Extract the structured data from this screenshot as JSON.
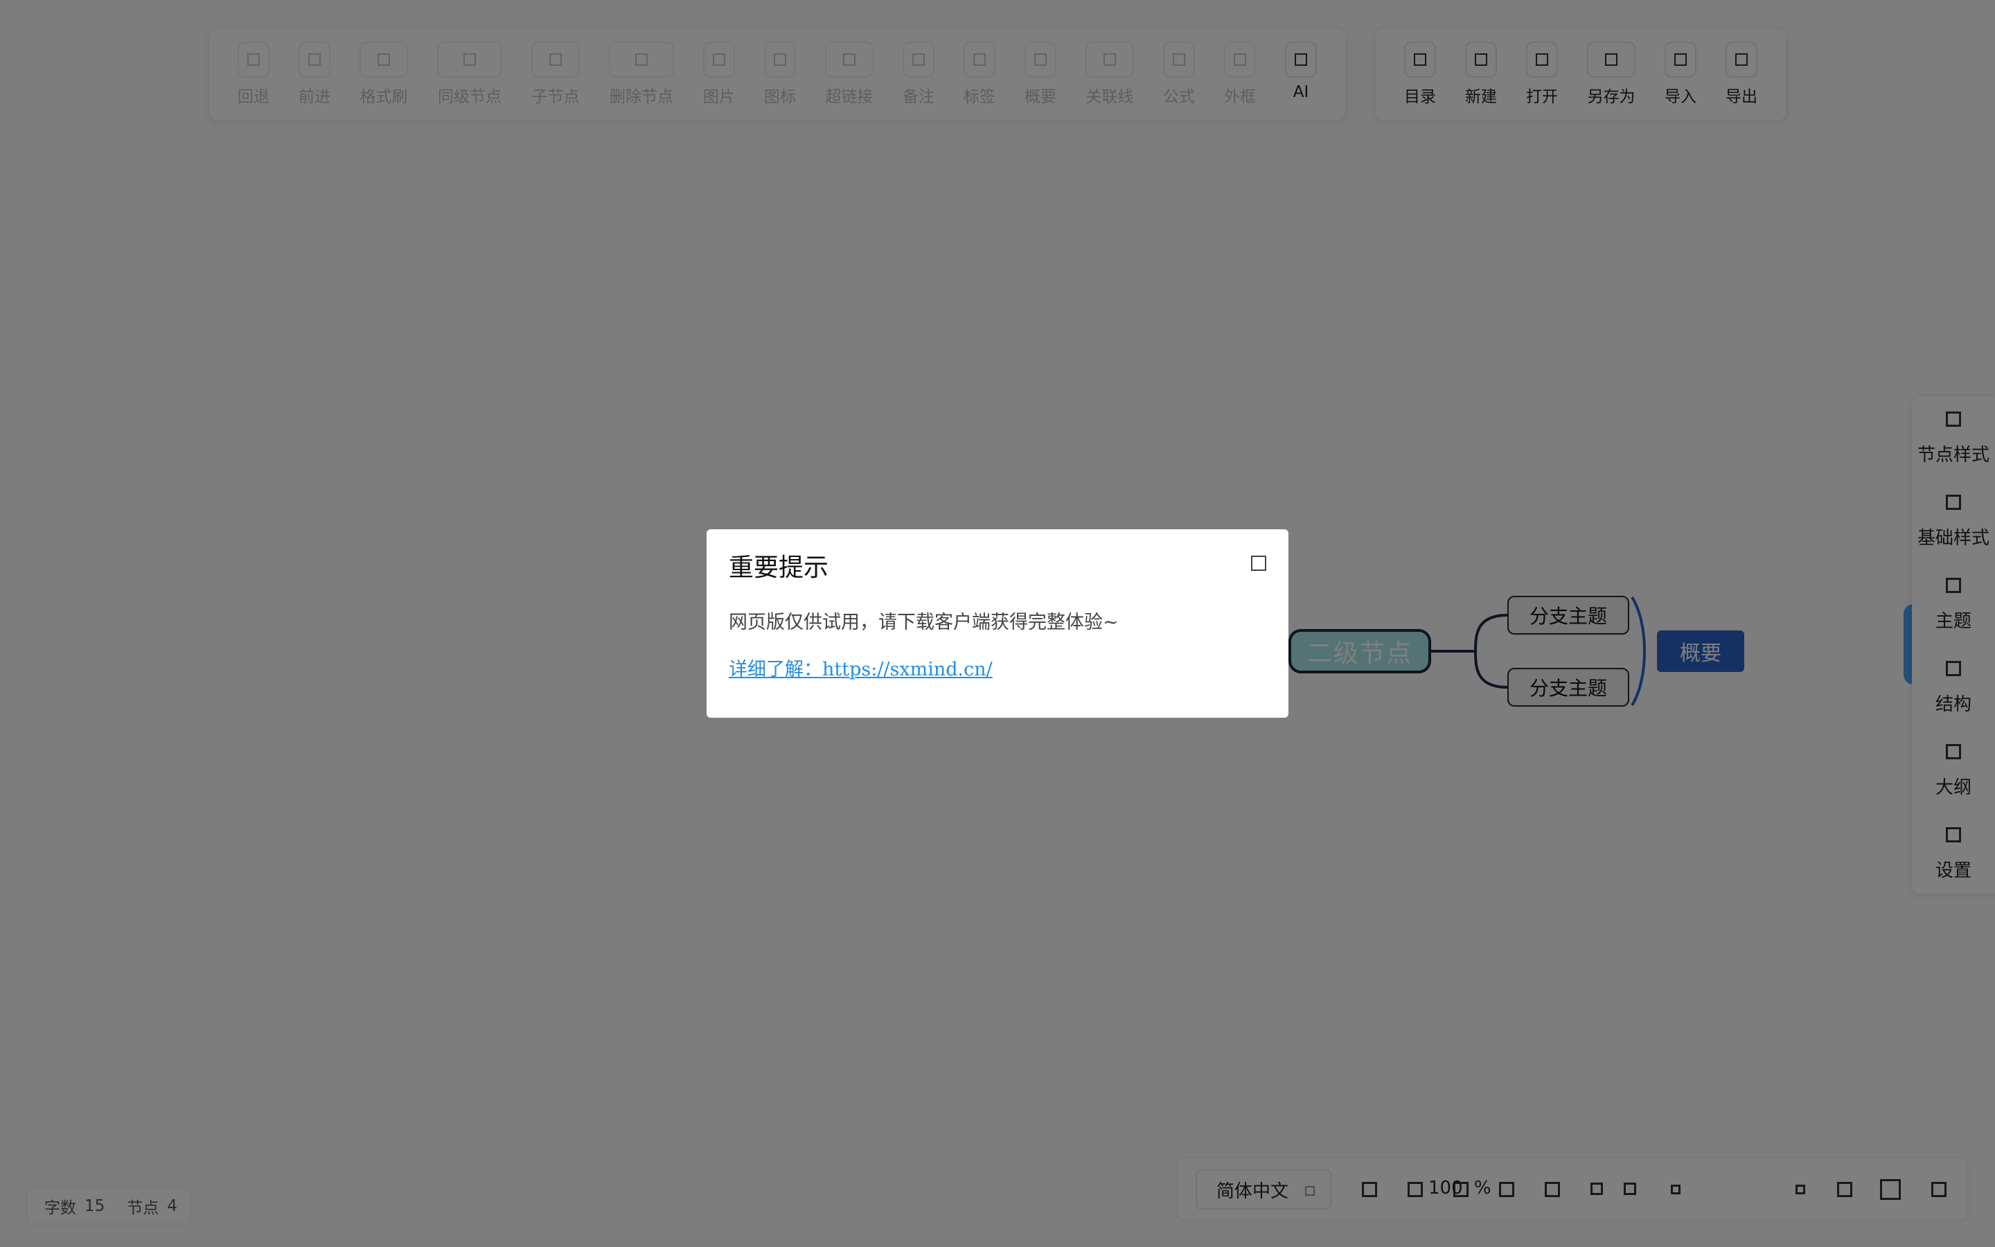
{
  "toolbar": {
    "edit_tools": [
      {
        "label": "回退",
        "icon": "undo-icon",
        "enabled": false
      },
      {
        "label": "前进",
        "icon": "redo-icon",
        "enabled": false
      },
      {
        "label": "格式刷",
        "icon": "format-painter-icon",
        "enabled": false
      },
      {
        "label": "同级节点",
        "icon": "sibling-node-icon",
        "enabled": false
      },
      {
        "label": "子节点",
        "icon": "child-node-icon",
        "enabled": false
      },
      {
        "label": "删除节点",
        "icon": "delete-node-icon",
        "enabled": false
      },
      {
        "label": "图片",
        "icon": "image-icon",
        "enabled": false
      },
      {
        "label": "图标",
        "icon": "icon-icon",
        "enabled": false
      },
      {
        "label": "超链接",
        "icon": "hyperlink-icon",
        "enabled": false
      },
      {
        "label": "备注",
        "icon": "note-icon",
        "enabled": false
      },
      {
        "label": "标签",
        "icon": "tag-icon",
        "enabled": false
      },
      {
        "label": "概要",
        "icon": "summary-icon",
        "enabled": false
      },
      {
        "label": "关联线",
        "icon": "association-line-icon",
        "enabled": false
      },
      {
        "label": "公式",
        "icon": "formula-icon",
        "enabled": false
      },
      {
        "label": "外框",
        "icon": "outer-frame-icon",
        "enabled": false
      },
      {
        "label": "AI",
        "icon": "ai-icon",
        "enabled": true
      }
    ],
    "file_tools": [
      {
        "label": "目录",
        "icon": "directory-icon"
      },
      {
        "label": "新建",
        "icon": "new-file-icon"
      },
      {
        "label": "打开",
        "icon": "open-file-icon"
      },
      {
        "label": "另存为",
        "icon": "save-as-icon"
      },
      {
        "label": "导入",
        "icon": "import-icon"
      },
      {
        "label": "导出",
        "icon": "export-icon"
      }
    ]
  },
  "mindmap": {
    "second_level_node": "二级节点",
    "branches": [
      "分支主题",
      "分支主题"
    ],
    "summary": "概要",
    "colors": {
      "second_node_fill": "#a8e6e8",
      "line": "#1c2a3f",
      "summary": "#2b63c9",
      "bracket": "#2b63c9"
    }
  },
  "sidebar": {
    "items": [
      {
        "label": "节点样式",
        "icon": "node-style-icon"
      },
      {
        "label": "基础样式",
        "icon": "base-style-icon"
      },
      {
        "label": "主题",
        "icon": "theme-icon"
      },
      {
        "label": "结构",
        "icon": "structure-icon"
      },
      {
        "label": "大纲",
        "icon": "outline-icon"
      },
      {
        "label": "设置",
        "icon": "settings-icon"
      }
    ]
  },
  "status": {
    "word_count_label": "字数",
    "word_count": "15",
    "node_count_label": "节点",
    "node_count": "4",
    "language": "简体中文",
    "zoom_value": "100",
    "zoom_unit": "%"
  },
  "modal": {
    "title": "重要提示",
    "message": "网页版仅供试用，请下载客户端获得完整体验~",
    "link_text": "详细了解：https://sxmind.cn/"
  }
}
